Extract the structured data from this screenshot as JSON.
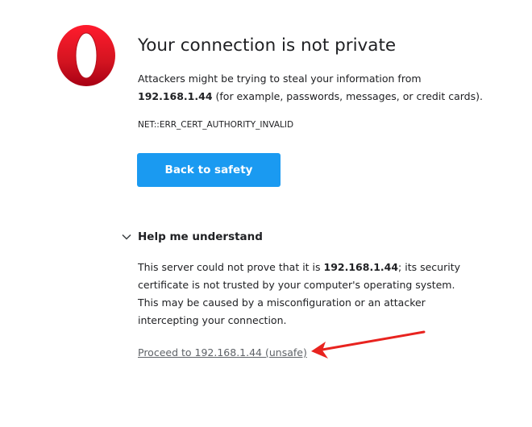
{
  "logo": {
    "icon": "opera-logo-icon",
    "color": "#d81920"
  },
  "heading": {
    "title": "Your connection is not private"
  },
  "description": {
    "prefix": "Attackers might be trying to steal your information from",
    "host": "192.168.1.44",
    "suffix": "(for example, passwords, messages, or credit cards)."
  },
  "error": {
    "code": "NET::ERR_CERT_AUTHORITY_INVALID"
  },
  "actions": {
    "back_label": "Back to safety",
    "back_color": "#1a9af1"
  },
  "help": {
    "toggle_label": "Help me understand",
    "toggle_icon": "chevron-down-icon",
    "explanation_prefix": "This server could not prove that it is",
    "explanation_host": "192.168.1.44",
    "explanation_suffix": "; its security certificate is not trusted by your computer's operating system. This may be caused by a misconfiguration or an attacker intercepting your connection.",
    "proceed_label": "Proceed to 192.168.1.44 (unsafe)"
  },
  "annotation": {
    "icon": "red-arrow-icon",
    "color": "#e8231f"
  }
}
